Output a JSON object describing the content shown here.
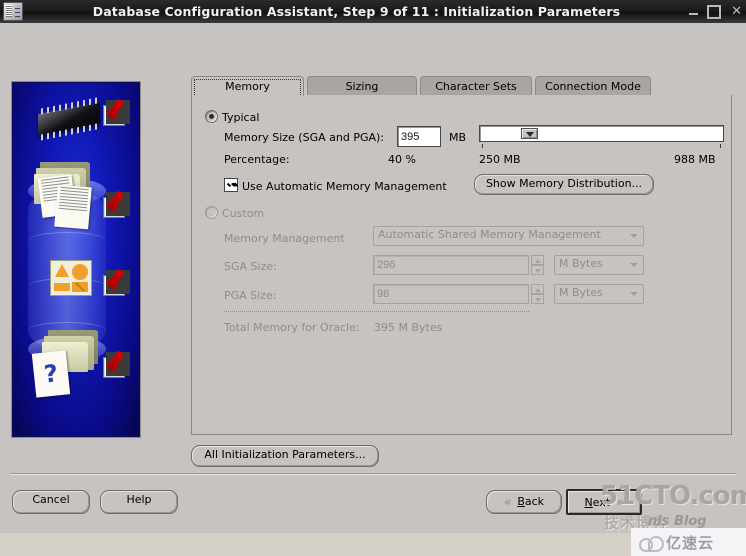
{
  "window": {
    "title": "Database Configuration Assistant, Step 9 of 11 : Initialization Parameters",
    "icon": "database-icon",
    "minimize_label": "_",
    "maximize_label": "□",
    "close_label": "✕"
  },
  "tabs": [
    {
      "label": "Memory",
      "active": true
    },
    {
      "label": "Sizing",
      "active": false
    },
    {
      "label": "Character Sets",
      "active": false
    },
    {
      "label": "Connection Mode",
      "active": false
    }
  ],
  "typical": {
    "radio_label": "Typical",
    "selected": true,
    "memory_size_label": "Memory Size (SGA and PGA):",
    "memory_size_value": "395",
    "memory_size_unit": "MB",
    "percentage_label": "Percentage:",
    "percentage_value": "40 %",
    "slider_min_label": "250 MB",
    "slider_max_label": "988 MB",
    "amm_checkbox_label": "Use Automatic Memory Management",
    "amm_checked": true,
    "show_distribution_button": "Show Memory Distribution..."
  },
  "custom": {
    "radio_label": "Custom",
    "selected": false,
    "memory_management_label": "Memory Management",
    "memory_management_value": "Automatic Shared Memory Management",
    "sga_label": "SGA Size:",
    "sga_value": "296",
    "sga_unit": "M Bytes",
    "pga_label": "PGA Size:",
    "pga_value": "98",
    "pga_unit": "M Bytes",
    "total_label": "Total Memory for Oracle:",
    "total_value": "395 M Bytes"
  },
  "actions": {
    "all_parameters": "All Initialization Parameters...",
    "cancel": "Cancel",
    "help": "Help",
    "back": "Back",
    "next": "Next",
    "back_icon": "«",
    "next_icon": "»"
  },
  "watermarks": {
    "site": "51CTO.com",
    "chinese": "技术博客",
    "blog": "nis Blog",
    "brand": "亿速云"
  },
  "colors": {
    "face": "#c6c3c0",
    "titlebar": "#1a1a1a",
    "tab_inactive": "#a8a5a2",
    "field_bg": "#ffffff",
    "disabled_text": "#8f8c89",
    "artwork_blue": "#1018b4",
    "check_red": "#cc0000"
  }
}
